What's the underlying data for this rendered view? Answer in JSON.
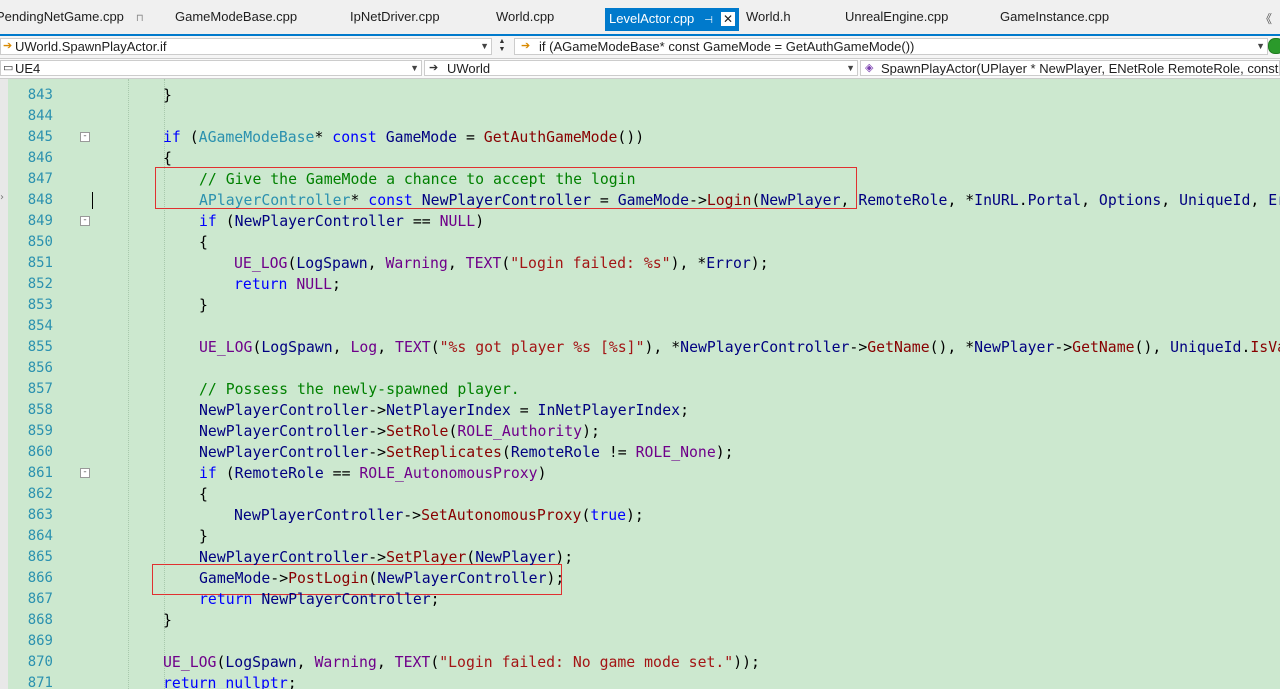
{
  "tabs": [
    {
      "label": "PendingNetGame.cpp",
      "pin": "⊓"
    },
    {
      "label": "GameModeBase.cpp"
    },
    {
      "label": "IpNetDriver.cpp"
    },
    {
      "label": "World.cpp"
    },
    {
      "label": "LevelActor.cpp",
      "pin": "⊣",
      "close": "✕",
      "active": true
    },
    {
      "label": "World.h"
    },
    {
      "label": "UnrealEngine.cpp"
    },
    {
      "label": "GameInstance.cpp"
    }
  ],
  "tab_scroll_icon": "《",
  "nav": {
    "left_symbol": "UWorld.SpawnPlayActor.if",
    "right_symbol": "if (AGameModeBase* const GameMode = GetAuthGameMode())",
    "project": "UE4",
    "scope": "UWorld",
    "member": "SpawnPlayActor(UPlayer * NewPlayer, ENetRole RemoteRole, const F"
  },
  "colors": {
    "background": "#cce8cf",
    "keyword": "#0000ff",
    "type": "#2b91af",
    "function": "#880000",
    "string": "#a31515",
    "comment": "#008000",
    "macro": "#6f008a",
    "variable": "#000080",
    "line_number": "#2b91af",
    "highlight_box": "#e03030"
  },
  "lines": [
    {
      "n": "843",
      "indent": 1,
      "tokens": [
        [
          "p",
          "}"
        ]
      ]
    },
    {
      "n": "844",
      "indent": 0,
      "tokens": []
    },
    {
      "n": "845",
      "indent": 1,
      "fold": "-",
      "tokens": [
        [
          "k",
          "if"
        ],
        [
          "p",
          " ("
        ],
        [
          "t",
          "AGameModeBase"
        ],
        [
          "p",
          "* "
        ],
        [
          "k",
          "const"
        ],
        [
          "p",
          " "
        ],
        [
          "v",
          "GameMode"
        ],
        [
          "p",
          " = "
        ],
        [
          "f",
          "GetAuthGameMode"
        ],
        [
          "p",
          "())"
        ]
      ]
    },
    {
      "n": "846",
      "indent": 1,
      "tokens": [
        [
          "p",
          "{"
        ]
      ]
    },
    {
      "n": "847",
      "indent": 2,
      "tokens": [
        [
          "c",
          "// Give the GameMode a chance to accept the login"
        ]
      ]
    },
    {
      "n": "848",
      "indent": 2,
      "tokens": [
        [
          "t",
          "APlayerController"
        ],
        [
          "p",
          "* "
        ],
        [
          "k",
          "const"
        ],
        [
          "p",
          " "
        ],
        [
          "v",
          "NewPlayerController"
        ],
        [
          "p",
          " = "
        ],
        [
          "v",
          "GameMode"
        ],
        [
          "p",
          "->"
        ],
        [
          "f",
          "Login"
        ],
        [
          "p",
          "("
        ],
        [
          "v",
          "NewPlayer"
        ],
        [
          "p",
          ", "
        ],
        [
          "v",
          "RemoteRole"
        ],
        [
          "p",
          ", *"
        ],
        [
          "v",
          "InURL"
        ],
        [
          "p",
          "."
        ],
        [
          "v",
          "Portal"
        ],
        [
          "p",
          ", "
        ],
        [
          "v",
          "Options"
        ],
        [
          "p",
          ", "
        ],
        [
          "v",
          "UniqueId"
        ],
        [
          "p",
          ", "
        ],
        [
          "v",
          "Error"
        ]
      ]
    },
    {
      "n": "849",
      "indent": 2,
      "fold": "-",
      "tokens": [
        [
          "k",
          "if"
        ],
        [
          "p",
          " ("
        ],
        [
          "v",
          "NewPlayerController"
        ],
        [
          "p",
          " == "
        ],
        [
          "m",
          "NULL"
        ],
        [
          "p",
          ")"
        ]
      ]
    },
    {
      "n": "850",
      "indent": 2,
      "tokens": [
        [
          "p",
          "{"
        ]
      ]
    },
    {
      "n": "851",
      "indent": 3,
      "tokens": [
        [
          "m",
          "UE_LOG"
        ],
        [
          "p",
          "("
        ],
        [
          "v",
          "LogSpawn"
        ],
        [
          "p",
          ", "
        ],
        [
          "m",
          "Warning"
        ],
        [
          "p",
          ", "
        ],
        [
          "m",
          "TEXT"
        ],
        [
          "p",
          "("
        ],
        [
          "s",
          "\"Login failed: %s\""
        ],
        [
          "p",
          "), *"
        ],
        [
          "v",
          "Error"
        ],
        [
          "p",
          ");"
        ]
      ]
    },
    {
      "n": "852",
      "indent": 3,
      "tokens": [
        [
          "k",
          "return"
        ],
        [
          "p",
          " "
        ],
        [
          "m",
          "NULL"
        ],
        [
          "p",
          ";"
        ]
      ]
    },
    {
      "n": "853",
      "indent": 2,
      "tokens": [
        [
          "p",
          "}"
        ]
      ]
    },
    {
      "n": "854",
      "indent": 0,
      "tokens": []
    },
    {
      "n": "855",
      "indent": 2,
      "tokens": [
        [
          "m",
          "UE_LOG"
        ],
        [
          "p",
          "("
        ],
        [
          "v",
          "LogSpawn"
        ],
        [
          "p",
          ", "
        ],
        [
          "m",
          "Log"
        ],
        [
          "p",
          ", "
        ],
        [
          "m",
          "TEXT"
        ],
        [
          "p",
          "("
        ],
        [
          "s",
          "\"%s got player %s [%s]\""
        ],
        [
          "p",
          "), *"
        ],
        [
          "v",
          "NewPlayerController"
        ],
        [
          "p",
          "->"
        ],
        [
          "f",
          "GetName"
        ],
        [
          "p",
          "(), *"
        ],
        [
          "v",
          "NewPlayer"
        ],
        [
          "p",
          "->"
        ],
        [
          "f",
          "GetName"
        ],
        [
          "p",
          "(), "
        ],
        [
          "v",
          "UniqueId"
        ],
        [
          "p",
          "."
        ],
        [
          "f",
          "IsValid"
        ]
      ]
    },
    {
      "n": "856",
      "indent": 0,
      "tokens": []
    },
    {
      "n": "857",
      "indent": 2,
      "tokens": [
        [
          "c",
          "// Possess the newly-spawned player."
        ]
      ]
    },
    {
      "n": "858",
      "indent": 2,
      "tokens": [
        [
          "v",
          "NewPlayerController"
        ],
        [
          "p",
          "->"
        ],
        [
          "v",
          "NetPlayerIndex"
        ],
        [
          "p",
          " = "
        ],
        [
          "v",
          "InNetPlayerIndex"
        ],
        [
          "p",
          ";"
        ]
      ]
    },
    {
      "n": "859",
      "indent": 2,
      "tokens": [
        [
          "v",
          "NewPlayerController"
        ],
        [
          "p",
          "->"
        ],
        [
          "f",
          "SetRole"
        ],
        [
          "p",
          "("
        ],
        [
          "m",
          "ROLE_Authority"
        ],
        [
          "p",
          ");"
        ]
      ]
    },
    {
      "n": "860",
      "indent": 2,
      "tokens": [
        [
          "v",
          "NewPlayerController"
        ],
        [
          "p",
          "->"
        ],
        [
          "f",
          "SetReplicates"
        ],
        [
          "p",
          "("
        ],
        [
          "v",
          "RemoteRole"
        ],
        [
          "p",
          " != "
        ],
        [
          "m",
          "ROLE_None"
        ],
        [
          "p",
          ");"
        ]
      ]
    },
    {
      "n": "861",
      "indent": 2,
      "fold": "-",
      "tokens": [
        [
          "k",
          "if"
        ],
        [
          "p",
          " ("
        ],
        [
          "v",
          "RemoteRole"
        ],
        [
          "p",
          " == "
        ],
        [
          "m",
          "ROLE_AutonomousProxy"
        ],
        [
          "p",
          ")"
        ]
      ]
    },
    {
      "n": "862",
      "indent": 2,
      "tokens": [
        [
          "p",
          "{"
        ]
      ]
    },
    {
      "n": "863",
      "indent": 3,
      "tokens": [
        [
          "v",
          "NewPlayerController"
        ],
        [
          "p",
          "->"
        ],
        [
          "f",
          "SetAutonomousProxy"
        ],
        [
          "p",
          "("
        ],
        [
          "k",
          "true"
        ],
        [
          "p",
          ");"
        ]
      ]
    },
    {
      "n": "864",
      "indent": 2,
      "tokens": [
        [
          "p",
          "}"
        ]
      ]
    },
    {
      "n": "865",
      "indent": 2,
      "tokens": [
        [
          "v",
          "NewPlayerController"
        ],
        [
          "p",
          "->"
        ],
        [
          "f",
          "SetPlayer"
        ],
        [
          "p",
          "("
        ],
        [
          "v",
          "NewPlayer"
        ],
        [
          "p",
          ");"
        ]
      ]
    },
    {
      "n": "866",
      "indent": 2,
      "tokens": [
        [
          "v",
          "GameMode"
        ],
        [
          "p",
          "->"
        ],
        [
          "f",
          "PostLogin"
        ],
        [
          "p",
          "("
        ],
        [
          "v",
          "NewPlayerController"
        ],
        [
          "p",
          ");"
        ]
      ]
    },
    {
      "n": "867",
      "indent": 2,
      "tokens": [
        [
          "k",
          "return"
        ],
        [
          "p",
          " "
        ],
        [
          "v",
          "NewPlayerController"
        ],
        [
          "p",
          ";"
        ]
      ]
    },
    {
      "n": "868",
      "indent": 1,
      "tokens": [
        [
          "p",
          "}"
        ]
      ]
    },
    {
      "n": "869",
      "indent": 0,
      "tokens": []
    },
    {
      "n": "870",
      "indent": 1,
      "tokens": [
        [
          "m",
          "UE_LOG"
        ],
        [
          "p",
          "("
        ],
        [
          "v",
          "LogSpawn"
        ],
        [
          "p",
          ", "
        ],
        [
          "m",
          "Warning"
        ],
        [
          "p",
          ", "
        ],
        [
          "m",
          "TEXT"
        ],
        [
          "p",
          "("
        ],
        [
          "s",
          "\"Login failed: No game mode set.\""
        ],
        [
          "p",
          "));"
        ]
      ]
    },
    {
      "n": "871",
      "indent": 1,
      "tokens": [
        [
          "k",
          "return"
        ],
        [
          "p",
          " "
        ],
        [
          "k",
          "nullptr"
        ],
        [
          "p",
          ";"
        ]
      ]
    }
  ]
}
